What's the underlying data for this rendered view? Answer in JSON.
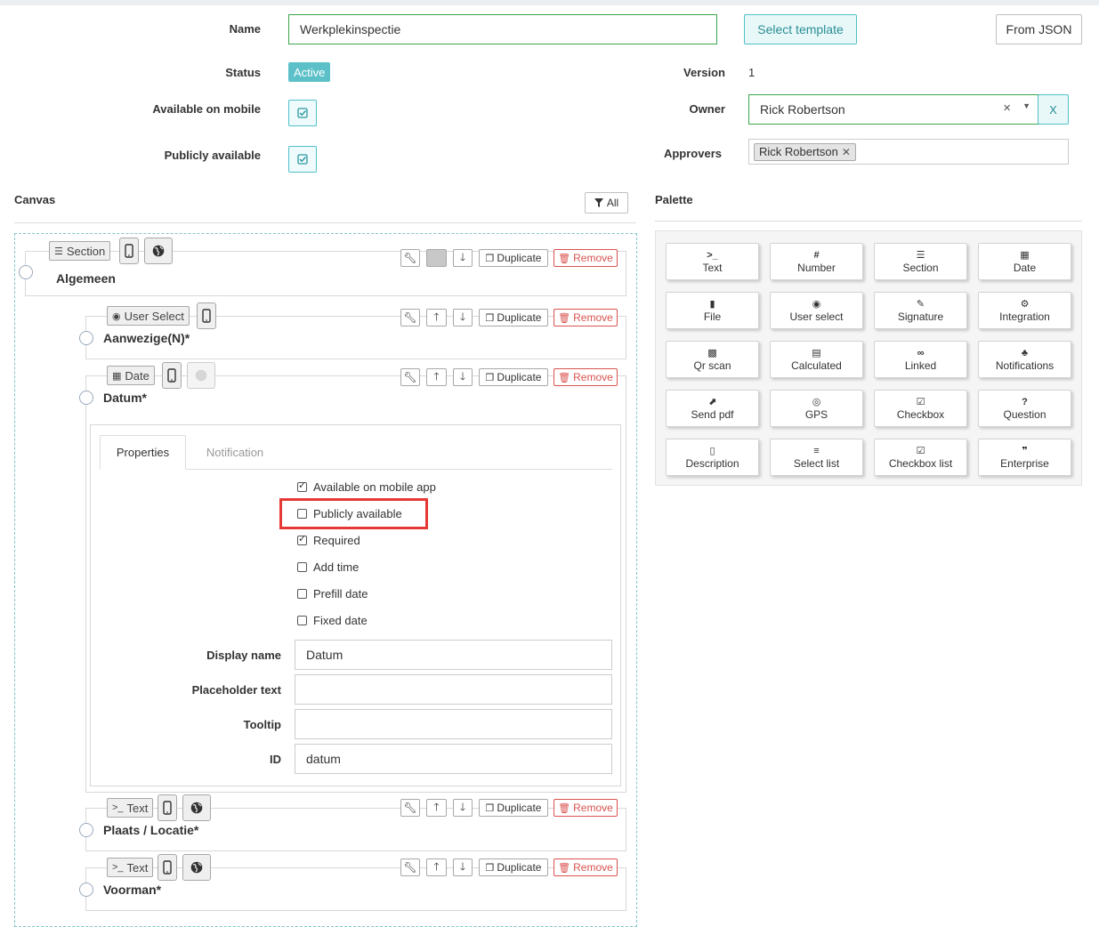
{
  "form": {
    "name_label": "Name",
    "name_value": "Werkplekinspectie",
    "select_template": "Select template",
    "from_json": "From JSON",
    "status_label": "Status",
    "status_value": "Active",
    "version_label": "Version",
    "version_value": "1",
    "mobile_label": "Available on mobile",
    "owner_label": "Owner",
    "owner_value": "Rick Robertson",
    "owner_clear": "×",
    "owner_x": "X",
    "public_label": "Publicly available",
    "approvers_label": "Approvers",
    "approver_tag": "Rick Robertson"
  },
  "canvas": {
    "title": "Canvas",
    "filter_all": "All",
    "tool_duplicate": "Duplicate",
    "tool_remove": "Remove",
    "items": [
      {
        "type_label": "Section",
        "title": "Algemeen"
      },
      {
        "type_label": "User Select",
        "title": "Aanwezige(N)*"
      },
      {
        "type_label": "Date",
        "title": "Datum*"
      },
      {
        "type_label": "Text",
        "title": "Plaats / Locatie*"
      },
      {
        "type_label": "Text",
        "title": "Voorman*"
      }
    ],
    "props": {
      "tabs": [
        "Properties",
        "Notification"
      ],
      "checkboxes": [
        {
          "label": "Available on mobile app",
          "checked": true
        },
        {
          "label": "Publicly available",
          "checked": false
        },
        {
          "label": "Required",
          "checked": true
        },
        {
          "label": "Add time",
          "checked": false
        },
        {
          "label": "Prefill date",
          "checked": false
        },
        {
          "label": "Fixed date",
          "checked": false
        }
      ],
      "fields": [
        {
          "label": "Display name",
          "value": "Datum"
        },
        {
          "label": "Placeholder text",
          "value": ""
        },
        {
          "label": "Tooltip",
          "value": ""
        },
        {
          "label": "ID",
          "value": "datum"
        }
      ]
    }
  },
  "palette": {
    "title": "Palette",
    "items": [
      {
        "icon": ">_",
        "label": "Text"
      },
      {
        "icon": "#",
        "label": "Number"
      },
      {
        "icon": "☰",
        "label": "Section"
      },
      {
        "icon": "▦",
        "label": "Date"
      },
      {
        "icon": "▮",
        "label": "File"
      },
      {
        "icon": "◉",
        "label": "User select"
      },
      {
        "icon": "✎",
        "label": "Signature"
      },
      {
        "icon": "⚙",
        "label": "Integration"
      },
      {
        "icon": "▩",
        "label": "Qr scan"
      },
      {
        "icon": "▤",
        "label": "Calculated"
      },
      {
        "icon": "∞",
        "label": "Linked"
      },
      {
        "icon": "♣",
        "label": "Notifications"
      },
      {
        "icon": "⬈",
        "label": "Send pdf"
      },
      {
        "icon": "◎",
        "label": "GPS"
      },
      {
        "icon": "☑",
        "label": "Checkbox"
      },
      {
        "icon": "?",
        "label": "Question"
      },
      {
        "icon": "▯",
        "label": "Description"
      },
      {
        "icon": "≡",
        "label": "Select list"
      },
      {
        "icon": "☑",
        "label": "Checkbox list"
      },
      {
        "icon": "❞",
        "label": "Enterprise"
      }
    ]
  },
  "colors": {
    "accent": "#4fc1c9",
    "active_badge": "#5bc0c8",
    "highlight": "#e53935",
    "remove": "#d9534f"
  }
}
